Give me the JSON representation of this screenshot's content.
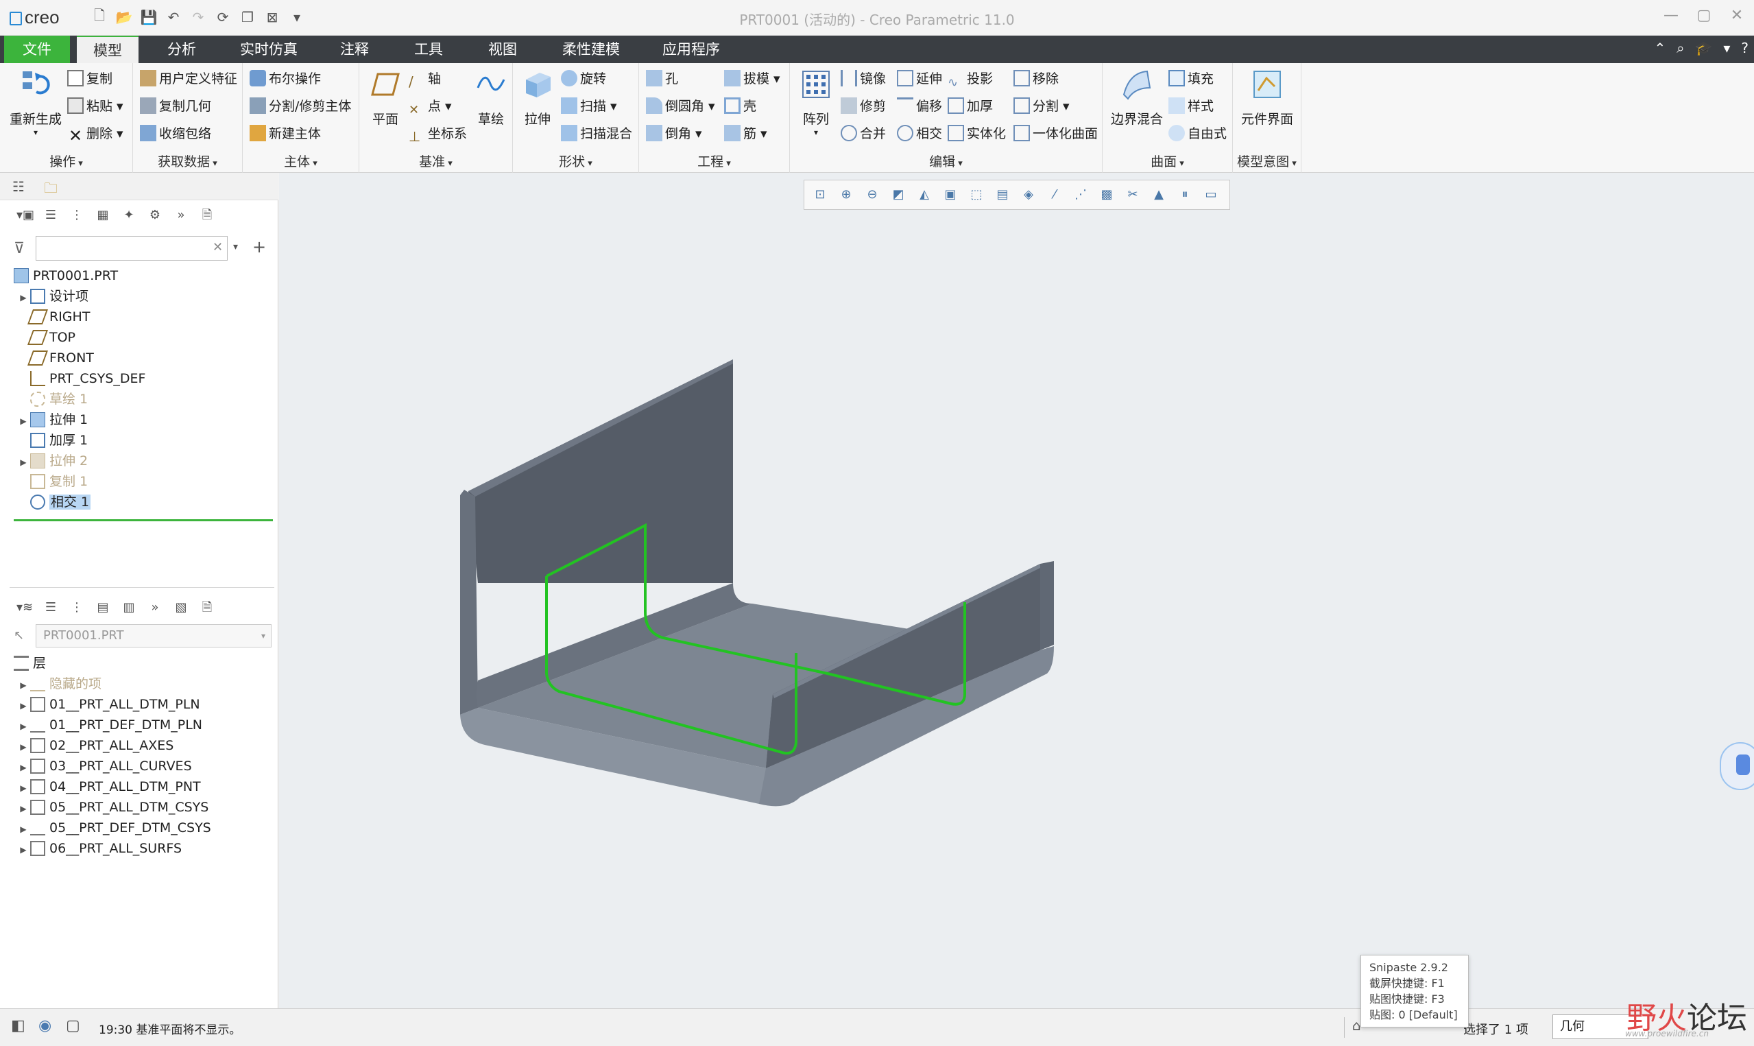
{
  "app": {
    "logo": "creo",
    "title": "PRT0001 (活动的) - Creo Parametric 11.0"
  },
  "tabs": [
    {
      "label": "文件"
    },
    {
      "label": "模型"
    },
    {
      "label": "分析"
    },
    {
      "label": "实时仿真"
    },
    {
      "label": "注释"
    },
    {
      "label": "工具"
    },
    {
      "label": "视图"
    },
    {
      "label": "柔性建模"
    },
    {
      "label": "应用程序"
    }
  ],
  "ribbon": {
    "operations": {
      "title": "操作",
      "regen": "重新生成",
      "copy": "复制",
      "paste": "粘贴",
      "delete": "删除"
    },
    "get_data": {
      "title": "获取数据",
      "udf": "用户定义特征",
      "copy_geom": "复制几何",
      "shrinkwrap": "收缩包络"
    },
    "body": {
      "title": "主体",
      "boolean": "布尔操作",
      "split": "分割/修剪主体",
      "new_body": "新建主体"
    },
    "datum": {
      "title": "基准",
      "plane": "平面",
      "axis": "轴",
      "point": "点",
      "csys": "坐标系",
      "sketch": "草绘"
    },
    "shapes": {
      "title": "形状",
      "extrude": "拉伸",
      "revolve": "旋转",
      "sweep": "扫描",
      "swept_blend": "扫描混合"
    },
    "engineering": {
      "title": "工程",
      "hole": "孔",
      "round": "倒圆角",
      "chamfer": "倒角",
      "draft": "拔模",
      "shell": "壳",
      "rib": "筋"
    },
    "editing": {
      "title": "编辑",
      "pattern": "阵列",
      "mirror": "镜像",
      "trim": "修剪",
      "merge": "合并",
      "extend": "延伸",
      "offset": "偏移",
      "intersect": "相交",
      "project": "投影",
      "thicken": "加厚",
      "solidify": "实体化",
      "remove": "移除",
      "split": "分割",
      "unify": "一体化曲面"
    },
    "surfaces": {
      "title": "曲面",
      "boundary": "边界混合",
      "fill": "填充",
      "style": "样式",
      "freestyle": "自由式"
    },
    "intent": {
      "title": "模型意图",
      "component_interface": "元件界面"
    }
  },
  "model_tree": {
    "root": "PRT0001.PRT",
    "items": [
      {
        "label": "设计项",
        "expandable": true
      },
      {
        "label": "RIGHT"
      },
      {
        "label": "TOP"
      },
      {
        "label": "FRONT"
      },
      {
        "label": "PRT_CSYS_DEF"
      },
      {
        "label": "草绘 1",
        "dimmed": true
      },
      {
        "label": "拉伸 1",
        "expandable": true
      },
      {
        "label": "加厚 1"
      },
      {
        "label": "拉伸 2",
        "dimmed": true,
        "expandable": true
      },
      {
        "label": "复制 1",
        "dimmed": true
      },
      {
        "label": "相交 1",
        "selected": true
      }
    ]
  },
  "layer_tree": {
    "model_select": "PRT0001.PRT",
    "header": "层",
    "items": [
      {
        "label": "隐藏的项",
        "dimmed": true
      },
      {
        "label": "01__PRT_ALL_DTM_PLN"
      },
      {
        "label": "01__PRT_DEF_DTM_PLN"
      },
      {
        "label": "02__PRT_ALL_AXES"
      },
      {
        "label": "03__PRT_ALL_CURVES"
      },
      {
        "label": "04__PRT_ALL_DTM_PNT"
      },
      {
        "label": "05__PRT_ALL_DTM_CSYS"
      },
      {
        "label": "05__PRT_DEF_DTM_CSYS"
      },
      {
        "label": "06__PRT_ALL_SURFS"
      }
    ]
  },
  "status": {
    "message": "19:30 基准平面将不显示。",
    "selection": "选择了 1 项",
    "filter": "几何"
  },
  "snipaste": {
    "line1": "Snipaste 2.9.2",
    "line2": "截屏快捷键: F1",
    "line3": "贴图快捷键: F3",
    "line4": "贴图: 0 [Default]"
  },
  "watermark": {
    "text1": "野火",
    "text2": "论坛",
    "url": "www.proewildfire.cn"
  },
  "colors": {
    "accent": "#3cb43c",
    "tab_bar": "#3a3e43",
    "model_face": "#7d8692",
    "model_dark": "#545b66",
    "curve": "#22c322"
  }
}
